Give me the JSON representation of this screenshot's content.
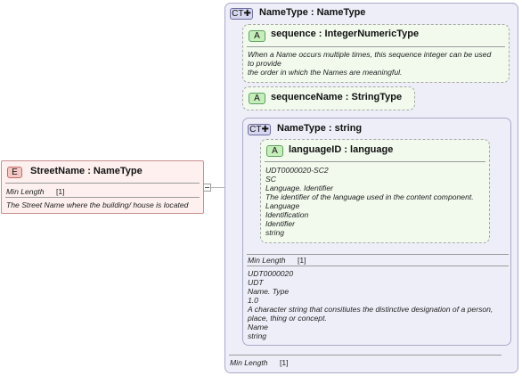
{
  "element": {
    "badge": "E",
    "title": "StreetName : NameType",
    "facet_label": "Min Length",
    "facet_value": "[1]",
    "doc": "The Street Name where the building/ house is located"
  },
  "outer_type": {
    "badge": "CT",
    "title": "NameType : NameType",
    "facet_label": "Min Length",
    "facet_value": "[1]"
  },
  "attr_sequence": {
    "badge": "A",
    "title": "sequence : IntegerNumericType",
    "doc": [
      "When a Name occurs multiple times, this sequence integer can be used",
      "to provide",
      "the order in which the Names are meaningful."
    ]
  },
  "attr_sequence_name": {
    "badge": "A",
    "title": "sequenceName : StringType"
  },
  "inner_type": {
    "badge": "CT",
    "title": "NameType : string",
    "facet_label": "Min Length",
    "facet_value": "[1]",
    "doc": [
      "UDT0000020",
      "UDT",
      "Name. Type",
      "1.0",
      "A character string that consitiutes the distinctive designation of a person,",
      "place, thing or concept.",
      "Name",
      "string"
    ]
  },
  "attr_language": {
    "badge": "A",
    "title": "languageID : language",
    "doc": [
      "UDT0000020-SC2",
      "SC",
      "Language. Identifier",
      "The identifier of the language used in the content component.",
      "Language",
      "Identification",
      "Identifier",
      "string"
    ]
  },
  "colors": {
    "element_fill": "#fdf0ef",
    "element_border": "#c98f8f",
    "type_fill": "#eeeef8",
    "type_border": "#aaaacb",
    "attr_fill": "#f1faed",
    "attr_border": "#a9a9a9",
    "attr_badge": "#c6eebb"
  }
}
